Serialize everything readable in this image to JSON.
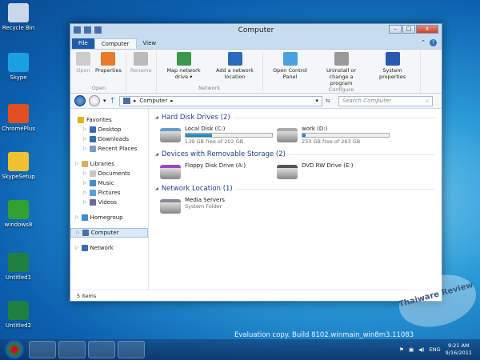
{
  "desktop": {
    "icons": [
      "Recycle Bin",
      "Skype",
      "ChromePlus",
      "SkypeSetup",
      "windows8",
      "Untitled1",
      "Untitled2"
    ]
  },
  "window": {
    "title": "Computer",
    "controls": {
      "minimize": "–",
      "maximize": "□",
      "close": "x"
    },
    "tabs": [
      "File",
      "Computer",
      "View"
    ],
    "ribbon": {
      "groups": [
        {
          "label": "Open",
          "buttons": [
            {
              "label": "Open",
              "disabled": true
            },
            {
              "label": "Properties",
              "disabled": false
            }
          ]
        },
        {
          "label": "",
          "buttons": [
            {
              "label": "Rename",
              "disabled": true
            }
          ]
        },
        {
          "label": "Network",
          "buttons": [
            {
              "label": "Map network drive ▾",
              "disabled": false
            },
            {
              "label": "Add a network location",
              "disabled": false
            }
          ]
        },
        {
          "label": "Configure",
          "buttons": [
            {
              "label": "Open Control Panel",
              "disabled": false
            },
            {
              "label": "Uninstall or change a program",
              "disabled": false
            },
            {
              "label": "System properties",
              "disabled": false
            }
          ]
        }
      ]
    },
    "address": {
      "path": "Computer",
      "separator": "▸",
      "search_placeholder": "Search Computer"
    },
    "sidebar": [
      {
        "label": "Favorites",
        "level": 0,
        "color": "#e8b020"
      },
      {
        "label": "Desktop",
        "level": 1,
        "color": "#3a6ab0"
      },
      {
        "label": "Downloads",
        "level": 1,
        "color": "#3a6ab0"
      },
      {
        "label": "Recent Places",
        "level": 1,
        "color": "#7a9ac0"
      },
      {
        "label": "",
        "level": -1
      },
      {
        "label": "Libraries",
        "level": 0,
        "color": "#d8b060"
      },
      {
        "label": "Documents",
        "level": 1,
        "color": "#c8c8c8"
      },
      {
        "label": "Music",
        "level": 1,
        "color": "#4a8ad0"
      },
      {
        "label": "Pictures",
        "level": 1,
        "color": "#5aa0d8"
      },
      {
        "label": "Videos",
        "level": 1,
        "color": "#6a6a9a"
      },
      {
        "label": "",
        "level": -1
      },
      {
        "label": "Homegroup",
        "level": 0,
        "color": "#3a8ad8"
      },
      {
        "label": "",
        "level": -1
      },
      {
        "label": "Computer",
        "level": 0,
        "color": "#4a6fa8",
        "selected": true
      },
      {
        "label": "",
        "level": -1
      },
      {
        "label": "Network",
        "level": 0,
        "color": "#3a6ab0"
      }
    ],
    "sections": [
      {
        "title": "Hard Disk Drives (2)",
        "items": [
          {
            "name": "Local Disk (C:)",
            "sub": "139 GB free of 202 GB",
            "used_fraction": 0.31
          },
          {
            "name": "work (D:)",
            "sub": "253 GB free of 263 GB",
            "used_fraction": 0.04
          }
        ]
      },
      {
        "title": "Devices with Removable Storage (2)",
        "items": [
          {
            "name": "Floppy Disk Drive (A:)"
          },
          {
            "name": "DVD RW Drive (E:)"
          }
        ]
      },
      {
        "title": "Network Location (1)",
        "items": [
          {
            "name": "Media Servers",
            "sub": "System Folder"
          }
        ]
      }
    ],
    "status": "5 items"
  },
  "watermark": "Evaluation copy. Build 8102.winmain_win8m3.11083",
  "logo": "Thaiware Review",
  "tray": {
    "lang": "ENG",
    "time": "9:21 AM",
    "date": "9/16/2011"
  }
}
